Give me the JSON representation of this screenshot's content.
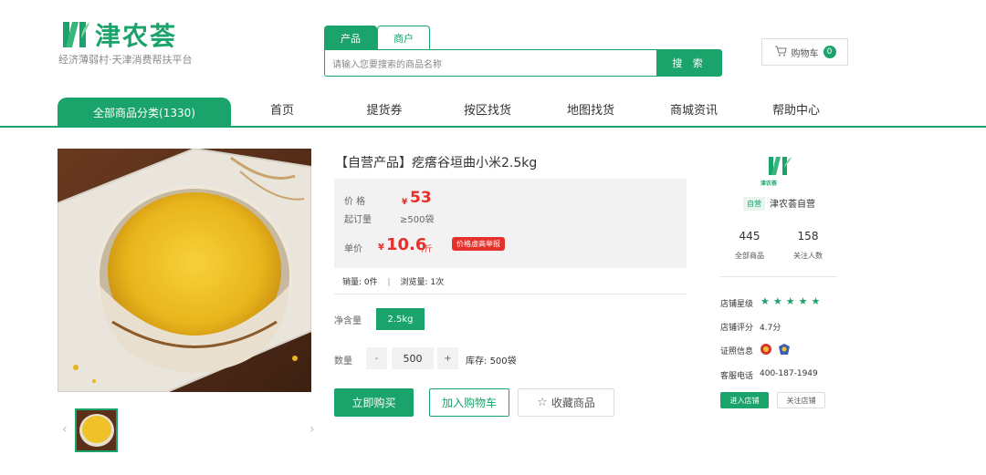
{
  "brand": {
    "name": "津农荟",
    "slogan": "经济薄弱村·天津消费帮扶平台"
  },
  "search": {
    "tabs": [
      {
        "label": "产品",
        "active": true
      },
      {
        "label": "商户",
        "active": false
      }
    ],
    "placeholder": "请输入您要搜索的商品名称",
    "button": "搜 索"
  },
  "cart": {
    "label": "购物车",
    "count": "0"
  },
  "nav": {
    "category": "全部商品分类(1330)",
    "items": [
      "首页",
      "提货券",
      "按区找货",
      "地图找货",
      "商城资讯",
      "帮助中心"
    ]
  },
  "product": {
    "title": "【自营产品】疙瘩谷垣曲小米2.5kg",
    "price_label": "价 格",
    "price_symbol": "¥",
    "price": "53",
    "moq_label": "起订量",
    "moq": "≥500袋",
    "unit_label": "单价",
    "unit_symbol": "¥",
    "unit_price": "10.6",
    "unit_suffix": "/斤",
    "price_tag": "价格虚高举报",
    "sales_label": "销量:",
    "sales": "0件",
    "views_label": "浏览量:",
    "views": "1次",
    "weight_label": "净含量",
    "weight": "2.5kg",
    "qty_label": "数量",
    "qty_minus": "-",
    "qty": "500",
    "qty_plus": "+",
    "stock_label": "库存:",
    "stock": "500袋",
    "buy_button": "立即购买",
    "cart_button": "加入购物车",
    "fav_button": "收藏商品"
  },
  "shop": {
    "logo_text": "津农荟",
    "badge": "自营",
    "name": "津农荟自营",
    "products": "445",
    "products_label": "全部商品",
    "followers": "158",
    "followers_label": "关注人数",
    "level_label": "店铺星级",
    "stars": "★★★★★",
    "score_label": "店铺评分",
    "score": "4.7分",
    "cert_label": "证照信息",
    "phone_label": "客服电话",
    "phone": "400-187-1949",
    "enter_button": "进入店铺",
    "follow_button": "关注店铺"
  },
  "colors": {
    "accent": "#1aa36a",
    "price": "#e5302c"
  }
}
